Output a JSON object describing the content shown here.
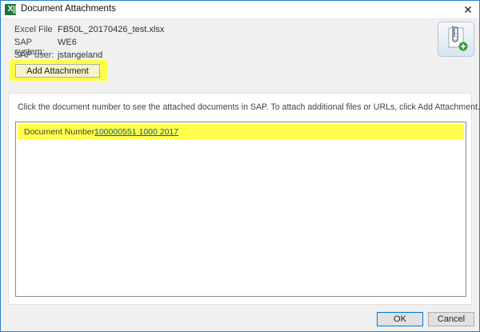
{
  "window": {
    "title": "Document Attachments",
    "close_glyph": "✕",
    "app_icon": "excel-icon"
  },
  "info": {
    "excel_file_label": "Excel File -",
    "excel_file_value": "FB50L_20170426_test.xlsx",
    "sap_system_label": "SAP system:",
    "sap_system_value": "WE6",
    "sap_user_label": "SAP user:",
    "sap_user_value": "jstangeland"
  },
  "toolbar": {
    "add_attachment_label": "Add Attachment",
    "attachment_icon": "paperclip-document-add-icon"
  },
  "panel": {
    "instructions": "Click the document number to see the attached documents in SAP. To attach additional files or URLs, click Add Attachment."
  },
  "documents": [
    {
      "label": "Document Number:",
      "number": "100000551 1000 2017"
    }
  ],
  "footer": {
    "ok_label": "OK",
    "cancel_label": "Cancel"
  },
  "colors": {
    "highlight": "#ffff4a",
    "link": "#0b57a4",
    "window_border": "#2d7dd2"
  }
}
